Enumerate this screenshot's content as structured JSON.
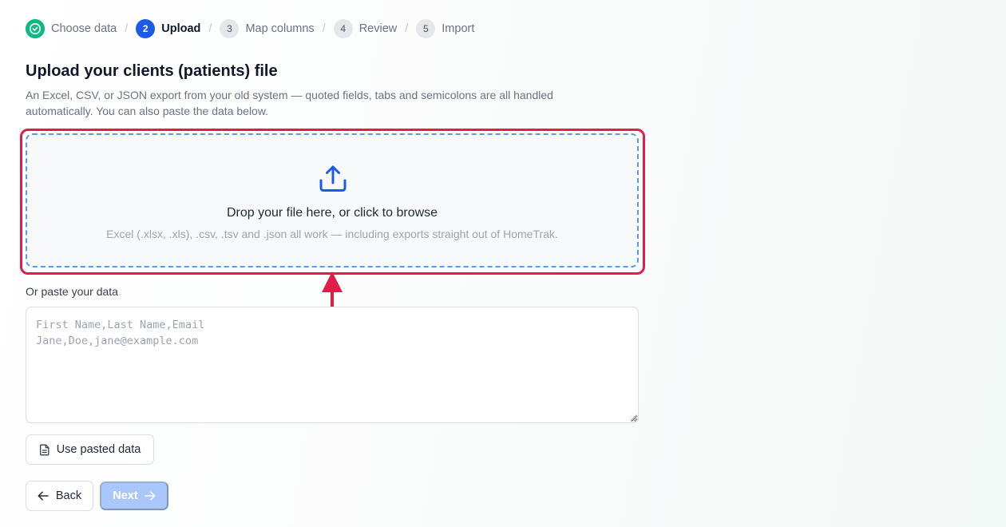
{
  "stepper": {
    "steps": [
      {
        "number": "",
        "label": "Choose data",
        "state": "done",
        "icon": "check-icon"
      },
      {
        "number": "2",
        "label": "Upload",
        "state": "active"
      },
      {
        "number": "3",
        "label": "Map columns",
        "state": "todo"
      },
      {
        "number": "4",
        "label": "Review",
        "state": "todo"
      },
      {
        "number": "5",
        "label": "Import",
        "state": "todo"
      }
    ],
    "separator": "/"
  },
  "header": {
    "title": "Upload your clients (patients) file",
    "description": "An Excel, CSV, or JSON export from your old system — quoted fields, tabs and semicolons are all handled automatically. You can also paste the data below."
  },
  "dropzone": {
    "icon": "upload-icon",
    "main_text": "Drop your file here, or click to browse",
    "sub_text": "Excel (.xlsx, .xls), .csv, .tsv and .json all work — including exports straight out of HomeTrak."
  },
  "paste": {
    "label": "Or paste your data",
    "value": "",
    "placeholder": "First Name,Last Name,Email\nJane,Doe,jane@example.com",
    "use_button_label": "Use pasted data",
    "use_button_icon": "document-icon"
  },
  "nav": {
    "back_label": "Back",
    "back_icon": "arrow-left-icon",
    "next_label": "Next",
    "next_icon": "arrow-right-icon",
    "next_disabled": true
  },
  "colors": {
    "accent": "#1d5ae8",
    "done": "#10b981",
    "highlight": "#e11d48",
    "dropzone_border": "#5a9be8",
    "next_disabled_bg": "#a9c7fa"
  }
}
